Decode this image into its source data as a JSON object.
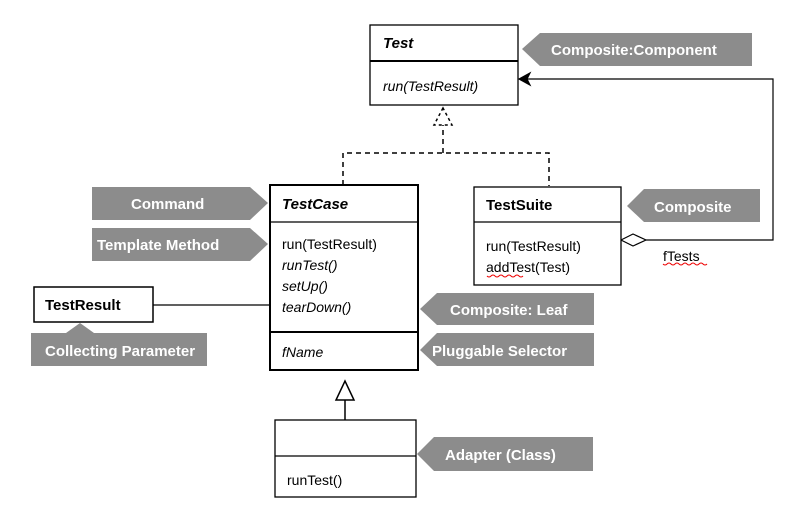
{
  "classes": {
    "test": {
      "name": "Test",
      "ops": [
        "run(TestResult)"
      ]
    },
    "testcase": {
      "name": "TestCase",
      "ops": [
        "run(TestResult)",
        "runTest()",
        "setUp()",
        "tearDown()"
      ],
      "fields": [
        "fName"
      ]
    },
    "testsuite": {
      "name": "TestSuite",
      "ops": [
        "run(TestResult)",
        "addTest(Test)"
      ]
    },
    "testresult": {
      "name": "TestResult"
    },
    "adapter": {
      "name": "",
      "ops": [
        "runTest()"
      ]
    }
  },
  "association_label": "fTests",
  "pattern_tags": {
    "composite_component": "Composite:Component",
    "command": "Command",
    "template_method": "Template Method",
    "composite": "Composite",
    "composite_leaf": "Composite: Leaf",
    "pluggable_selector": "Pluggable Selector",
    "collecting_parameter": "Collecting Parameter",
    "adapter_class": "Adapter (Class)"
  },
  "colors": {
    "tag_fill": "#8c8c8c",
    "tag_text": "#ffffff",
    "line": "#000000"
  }
}
